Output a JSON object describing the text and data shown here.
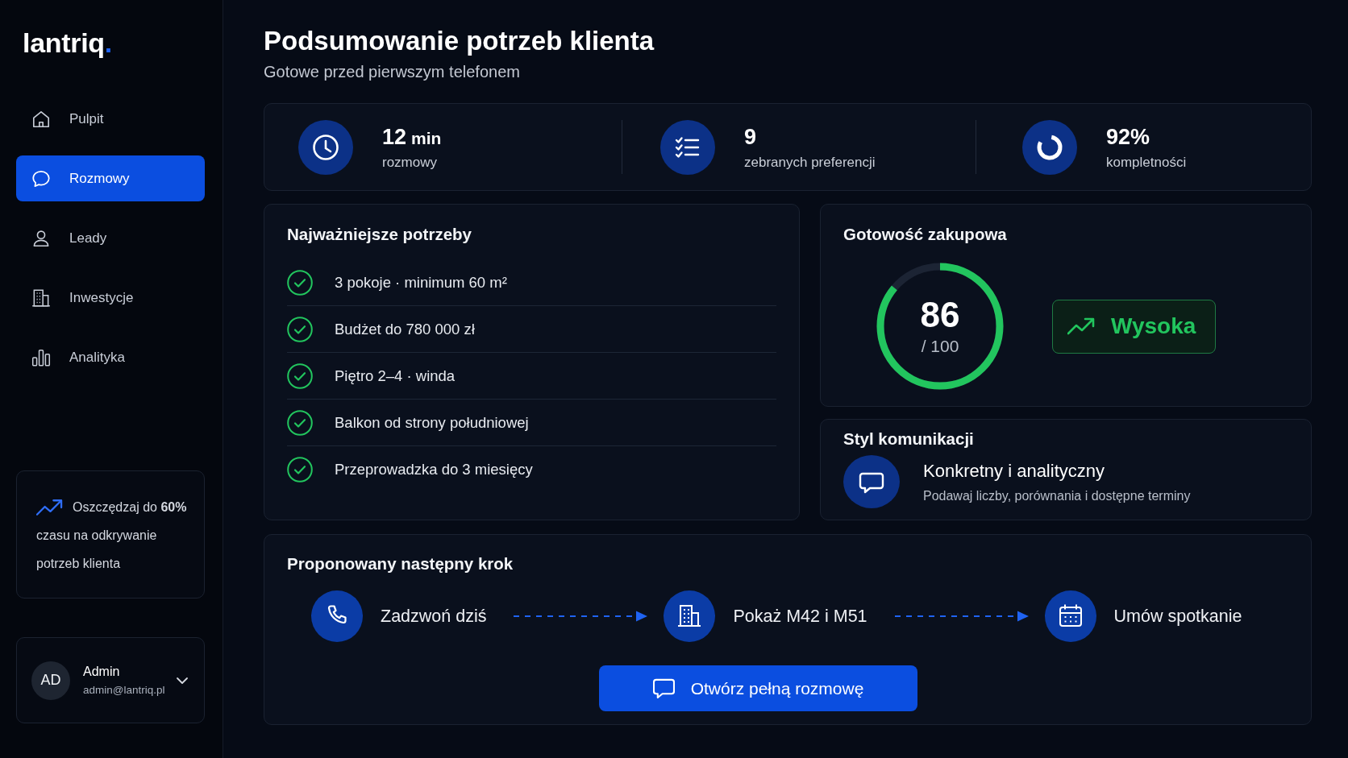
{
  "sidebar": {
    "logo": {
      "name": "lantriq",
      "mark": "."
    },
    "nav": [
      {
        "label": "Pulpit",
        "selected": false
      },
      {
        "label": "Rozmowy",
        "selected": true
      },
      {
        "label": "Leady",
        "selected": false
      },
      {
        "label": "Inwestycje",
        "selected": false
      },
      {
        "label": "Analityka",
        "selected": false
      }
    ],
    "promo": {
      "headline": "Oszczędzaj do **60%**",
      "text": "czasu na odkrywanie potrzeb klienta"
    },
    "user": {
      "initials": "AD",
      "name": "Admin",
      "email": "admin@lantriq.pl"
    }
  },
  "header": {
    "title": "Podsumowanie potrzeb klienta",
    "subtitle": "Gotowe przed pierwszym telefonem"
  },
  "stats": [
    {
      "value": "12",
      "unit": "min",
      "label": "rozmowy"
    },
    {
      "value": "9",
      "label": "zebranych preferencji"
    },
    {
      "value": "92%",
      "label": "kompletności"
    }
  ],
  "needs": {
    "title": "Najważniejsze potrzeby",
    "items": [
      {
        "text": "3 pokoje · minimum 60 m²",
        "checked": true
      },
      {
        "text": "Budżet do 780 000 zł",
        "checked": true
      },
      {
        "text": "Piętro 2–4 · winda",
        "checked": true
      },
      {
        "text": "Balkon od strony południowej",
        "checked": true
      },
      {
        "text": "Przeprowadzka do 3 miesięcy",
        "checked": true
      }
    ]
  },
  "readiness": {
    "title": "Gotowość zakupowa",
    "score": "86",
    "max": "/ 100",
    "level": 0.86,
    "badge": "Wysoka"
  },
  "style": {
    "title": "Styl komunikacji",
    "name": "Konkretny i analityczny",
    "hint": "Podawaj liczby, porównania i dostępne terminy"
  },
  "next_step": {
    "title": "Proponowany następny krok",
    "steps": [
      {
        "label": "Zadzwoń dziś"
      },
      {
        "label": "Pokaż M42 i M51"
      },
      {
        "label": "Umów spotkanie"
      }
    ],
    "button": "Otwórz pełną rozmowę"
  }
}
